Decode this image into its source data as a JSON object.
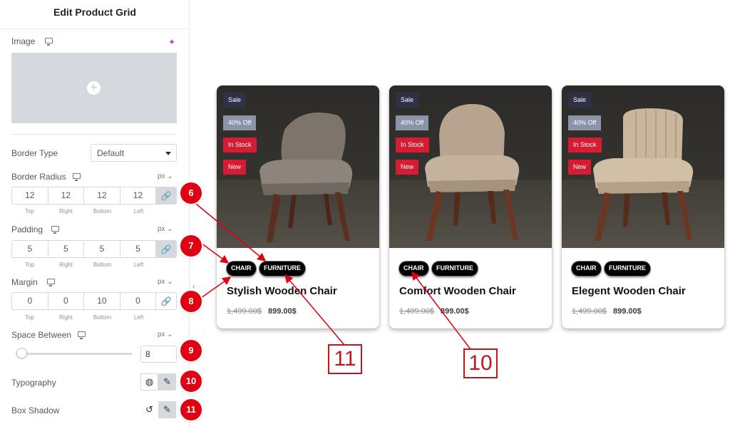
{
  "panel": {
    "title": "Edit Product Grid",
    "image_label": "Image",
    "border_type_label": "Border Type",
    "border_type_value": "Default",
    "border_radius": {
      "label": "Border Radius",
      "unit": "px",
      "values": [
        "12",
        "12",
        "12",
        "12"
      ]
    },
    "padding": {
      "label": "Padding",
      "unit": "px",
      "values": [
        "5",
        "5",
        "5",
        "5"
      ]
    },
    "margin": {
      "label": "Margin",
      "unit": "px",
      "values": [
        "0",
        "0",
        "10",
        "0"
      ]
    },
    "dim_labels": [
      "Top",
      "Right",
      "Bottom",
      "Left"
    ],
    "space_between": {
      "label": "Space Between",
      "unit": "px",
      "value": "8"
    },
    "typography_label": "Typography",
    "box_shadow_label": "Box Shadow"
  },
  "badges": {
    "sale": "Sale",
    "off": "40% Off",
    "stock": "In Stock",
    "new": "New"
  },
  "tags": {
    "chair": "CHAIR",
    "furniture": "FURNITURE"
  },
  "products": [
    {
      "title": "Stylish Wooden Chair",
      "old_price": "1,499.00$",
      "price": "899.00$"
    },
    {
      "title": "Comfort Wooden Chair",
      "old_price": "1,499.00$",
      "price": "899.00$"
    },
    {
      "title": "Elegent Wooden Chair",
      "old_price": "1,499.00$",
      "price": "899.00$"
    }
  ],
  "annotations": {
    "n6": "6",
    "n7": "7",
    "n8": "8",
    "n9": "9",
    "n10": "10",
    "n11": "11",
    "box10": "10",
    "box11": "11"
  },
  "colors": {
    "accent_red": "#e00012",
    "sale_badge": "#2f3147",
    "off_badge": "#8c95a8",
    "stock_badge": "#d61c32"
  }
}
